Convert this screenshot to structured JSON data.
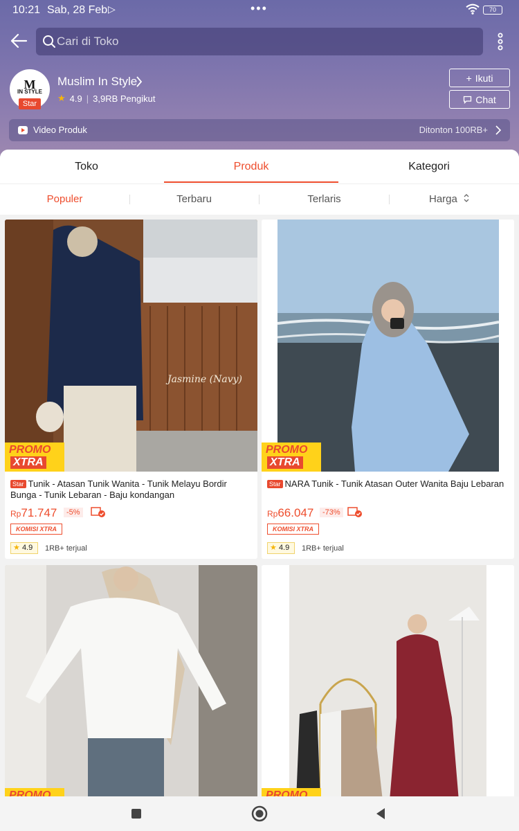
{
  "status": {
    "time": "10:21",
    "date": "Sab, 28 Feb",
    "battery": "70"
  },
  "search": {
    "placeholder": "Cari di Toko"
  },
  "shop": {
    "logo_text": "M",
    "logo_sub": "IN STYLE",
    "badge": "Star",
    "name": "Muslim In Style",
    "rating": "4.9",
    "followers": "3,9RB Pengikut",
    "follow_label": "Ikuti",
    "chat_label": "Chat"
  },
  "video": {
    "label": "Video Produk",
    "views": "Ditonton 100RB+"
  },
  "tabs": [
    {
      "label": "Toko"
    },
    {
      "label": "Produk"
    },
    {
      "label": "Kategori"
    }
  ],
  "sort": [
    {
      "label": "Populer"
    },
    {
      "label": "Terbaru"
    },
    {
      "label": "Terlaris"
    },
    {
      "label": "Harga"
    }
  ],
  "colors": {
    "accent": "#ee4d2d",
    "promo_yellow": "#ffd21a"
  },
  "promo": {
    "line1": "PROMO",
    "line2": "XTRA"
  },
  "products": [
    {
      "badge": "Star",
      "title": "Tunik - Atasan Tunik Wanita - Tunik Melayu Bordir Bunga - Tunik Lebaran - Baju kondangan",
      "currency": "Rp",
      "price": "71.747",
      "discount": "-5%",
      "komisi": "KOMISI XTRA",
      "rating": "4.9",
      "sold": "1RB+ terjual",
      "photo_caption": "Jasmine (Navy)"
    },
    {
      "badge": "Star",
      "title": "NARA Tunik - Tunik Atasan Outer Wanita Baju Lebaran",
      "currency": "Rp",
      "price": "66.047",
      "discount": "-73%",
      "komisi": "KOMISI XTRA",
      "rating": "4.9",
      "sold": "1RB+ terjual"
    }
  ]
}
